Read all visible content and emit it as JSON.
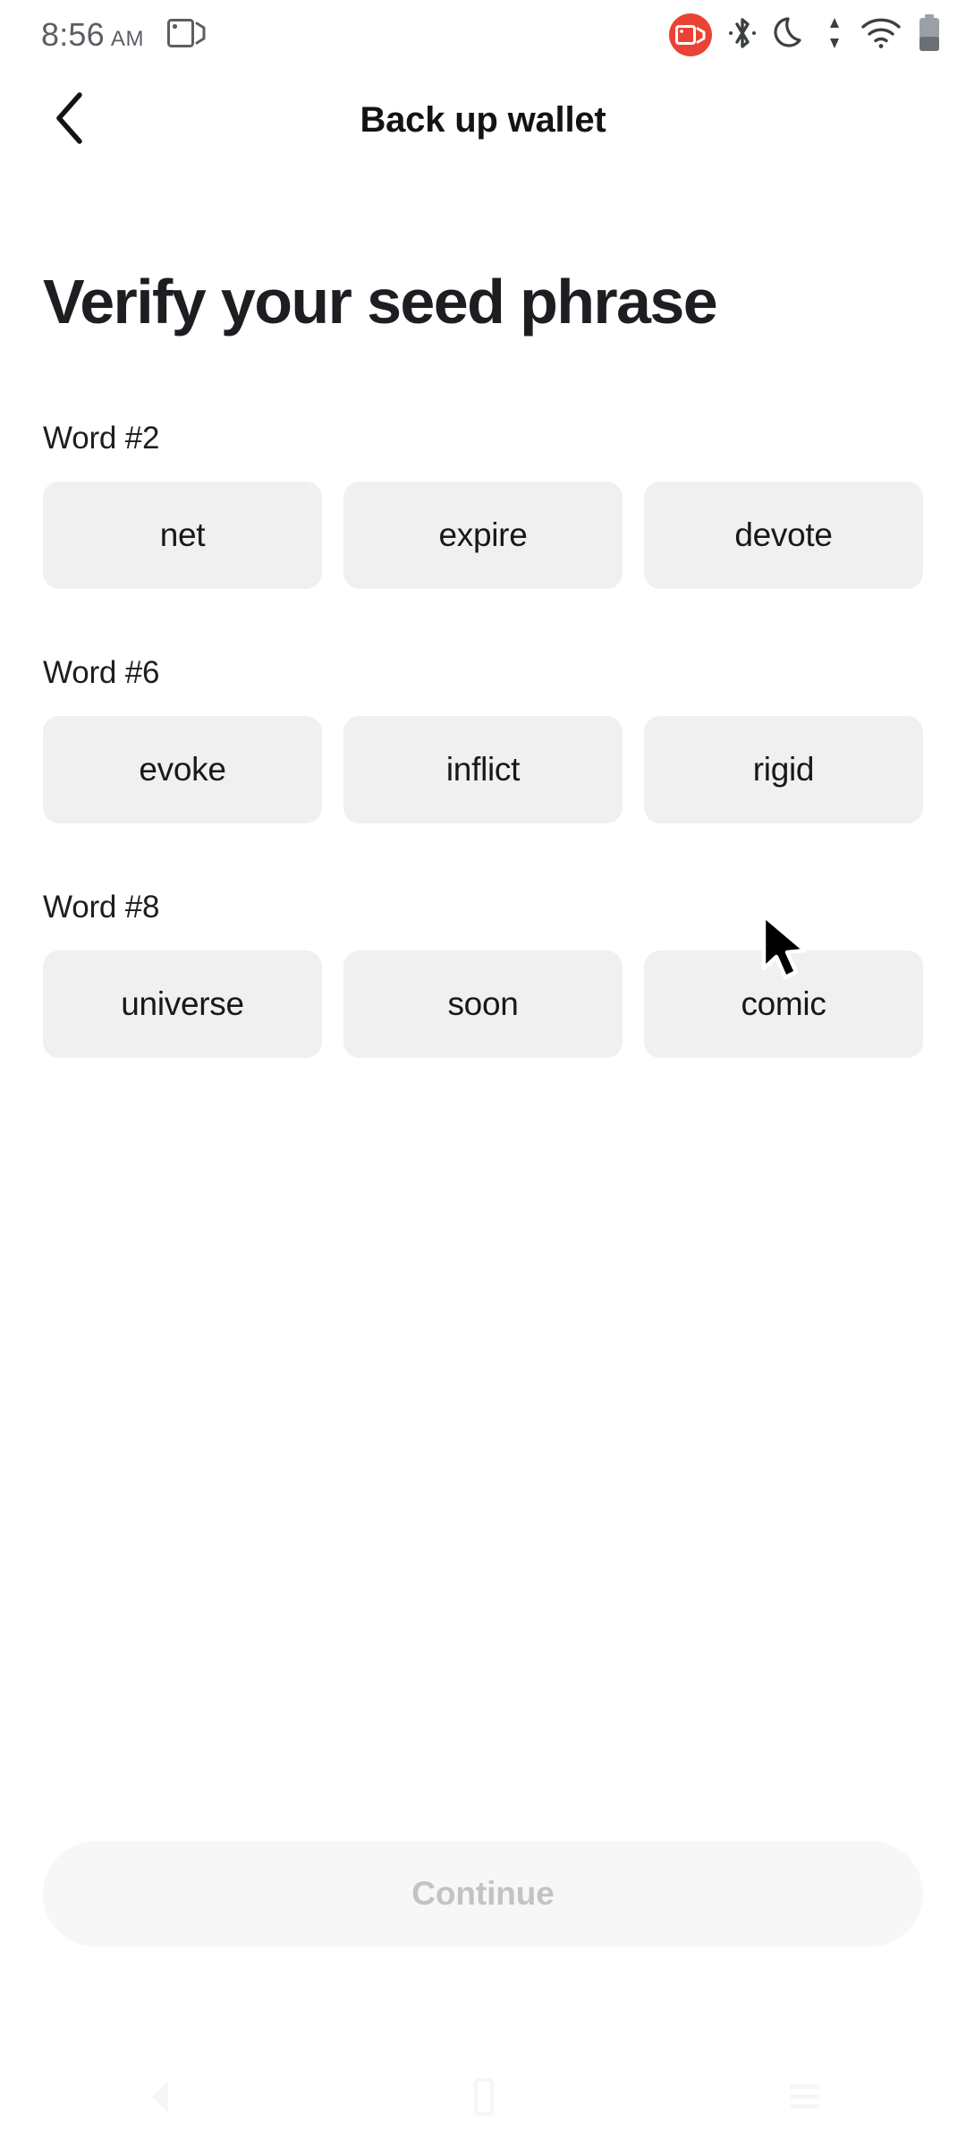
{
  "status_bar": {
    "time": "8:56",
    "ampm": "AM",
    "icons": {
      "cast": "screen-cast-icon",
      "recording": "screen-recording-icon",
      "bluetooth": "bluetooth-icon",
      "dnd": "do-not-disturb-moon-icon",
      "data": "data-transfer-icon",
      "wifi": "wifi-icon",
      "battery": "battery-icon"
    }
  },
  "app_bar": {
    "back_icon": "chevron-left-icon",
    "title": "Back up wallet"
  },
  "page": {
    "title": "Verify your seed phrase"
  },
  "word_groups": [
    {
      "label": "Word #2",
      "options": [
        "net",
        "expire",
        "devote"
      ]
    },
    {
      "label": "Word #6",
      "options": [
        "evoke",
        "inflict",
        "rigid"
      ]
    },
    {
      "label": "Word #8",
      "options": [
        "universe",
        "soon",
        "comic"
      ]
    }
  ],
  "continue_button": {
    "label": "Continue",
    "state": "disabled"
  },
  "nav_bar": {
    "back": "nav-back-icon",
    "home": "nav-home-icon",
    "recents": "nav-recents-icon"
  },
  "colors": {
    "background": "#ffffff",
    "chip_bg": "#f0f0f0",
    "text_primary": "#1c1e21",
    "text_muted": "#5b5f63",
    "recording_red": "#ea4335",
    "continue_disabled_bg": "#f7f7f7",
    "continue_disabled_text": "#c2c3c5"
  }
}
